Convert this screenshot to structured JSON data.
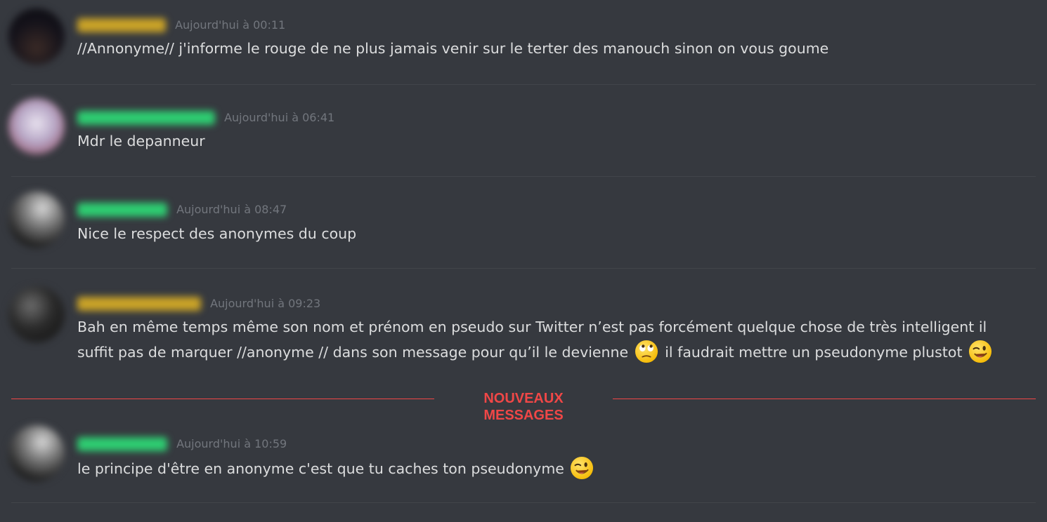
{
  "colors": {
    "background": "#36393f",
    "text": "#dcddde",
    "timestamp": "#72767d",
    "separator": "#42454a",
    "new_messages": "#f04747"
  },
  "messages": [
    {
      "avatar": "blurred-avatar",
      "username_color": "#c9a227",
      "timestamp": "Aujourd'hui à 00:11",
      "text": "//Annonyme// j'informe le rouge de ne plus jamais venir sur le terter des manouch sinon on vous goume"
    },
    {
      "avatar": "blurred-avatar",
      "username_color": "#2ecc71",
      "timestamp": "Aujourd'hui à 06:41",
      "text": "Mdr le depanneur"
    },
    {
      "avatar": "blurred-avatar",
      "username_color": "#2ecc71",
      "timestamp": "Aujourd'hui à 08:47",
      "text": "Nice le respect des anonymes du coup"
    },
    {
      "avatar": "blurred-avatar",
      "username_color": "#c9a227",
      "timestamp": "Aujourd'hui à 09:23",
      "text_line1": "Bah en même temps même son nom et prénom en pseudo sur Twitter n’est pas forcément quelque chose de très intelligent il",
      "text_line2a": "suffit pas de marquer //anonyme // dans son message pour qu’il le devienne",
      "emoji1": "face-with-rolling-eyes-icon",
      "text_line2b": "il faudrait mettre un pseudonyme plustot",
      "emoji2": "winking-face-icon"
    },
    {
      "avatar": "blurred-avatar",
      "username_color": "#2ecc71",
      "timestamp": "Aujourd'hui à 10:59",
      "text": "le principe d'être en anonyme c'est que tu caches ton pseudonyme",
      "emoji": "winking-face-icon"
    }
  ],
  "new_messages_label": "NOUVEAUX MESSAGES"
}
